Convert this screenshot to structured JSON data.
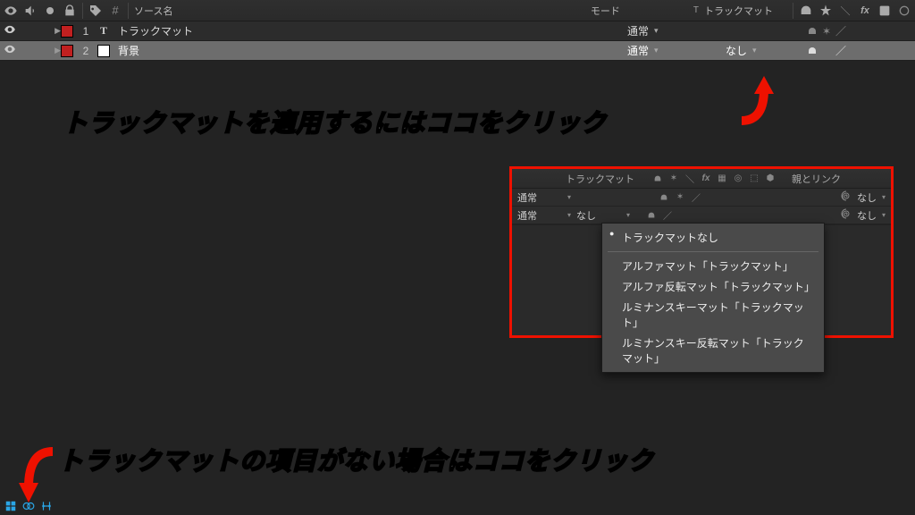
{
  "header": {
    "source_name_label": "ソース名",
    "mode_label": "モード",
    "trackmatte_label": "トラックマット",
    "trackmatte_short": "T"
  },
  "layers": [
    {
      "number": "1",
      "type": "T",
      "name": "トラックマット",
      "mode": "通常",
      "track_matte": ""
    },
    {
      "number": "2",
      "type": "solid",
      "name": "背景",
      "mode": "通常",
      "track_matte": "なし"
    }
  ],
  "annot": {
    "line1": "トラックマットを適用するにはココをクリック",
    "line2": "トラックマットの項目がない場合はココをクリック"
  },
  "popup": {
    "cols": {
      "trackmatte": "トラックマット",
      "parent": "親とリンク"
    },
    "rows": [
      {
        "mode": "通常",
        "trk": "",
        "parent": "なし"
      },
      {
        "mode": "通常",
        "trk": "なし",
        "parent": "なし"
      }
    ],
    "menu": {
      "selected": "トラックマットなし",
      "items": [
        "アルファマット「トラックマット」",
        "アルファ反転マット「トラックマット」",
        "ルミナンスキーマット「トラックマット」",
        "ルミナンスキー反転マット「トラックマット」"
      ]
    }
  }
}
